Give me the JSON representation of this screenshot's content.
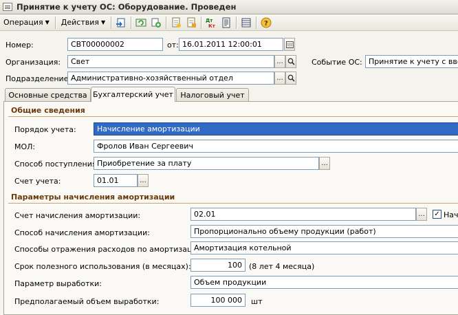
{
  "window": {
    "title": "Принятие к учету ОС: Оборудование. Проведен"
  },
  "toolbar": {
    "operation_label": "Операция",
    "actions_label": "Действия",
    "icons": [
      "post-icon",
      "refresh-icon",
      "copy-icon",
      "add-row-icon",
      "report-icon",
      "dt-kt-icon",
      "print-icon",
      "list-icon",
      "help-icon"
    ]
  },
  "header": {
    "number_label": "Номер:",
    "number_value": "СВТ00000002",
    "from_label": "от:",
    "date_value": "16.01.2011 12:00:01",
    "org_label": "Организация:",
    "org_value": "Свет",
    "event_label": "Событие ОС:",
    "event_value": "Принятие к учету с вводом",
    "dept_label": "Подразделение:",
    "dept_value": "Административно-хозяйственный отдел"
  },
  "tabs": [
    {
      "label": "Основные средства"
    },
    {
      "label": "Бухгалтерский учет"
    },
    {
      "label": "Налоговый учет"
    }
  ],
  "general": {
    "title": "Общие сведения",
    "order_label": "Порядок учета:",
    "order_value": "Начисление амортизации",
    "mol_label": "МОЛ:",
    "mol_value": "Фролов Иван  Сергеевич",
    "receipt_label": "Способ поступления:",
    "receipt_value": "Приобретение за плату",
    "account_label": "Счет учета:",
    "account_value": "01.01"
  },
  "depreciation": {
    "title": "Параметры начисления амортизации",
    "account_label": "Счет начисления амортизации:",
    "account_value": "02.01",
    "checkbox_label": "Начи",
    "method_label": "Способ начисления амортизации:",
    "method_value": "Пропорционально объему продукции (работ)",
    "expense_label": "Способы отражения расходов по амортизации:",
    "expense_value": "Амортизация котельной",
    "life_label": "Срок полезного использования (в месяцах):",
    "life_value": "100",
    "life_note": "(8 лет 4 месяца)",
    "param_label": "Параметр выработки:",
    "param_value": "Объем продукции",
    "volume_label": "Предполагаемый объем выработки:",
    "volume_value": "100 000",
    "volume_unit": "шт"
  }
}
